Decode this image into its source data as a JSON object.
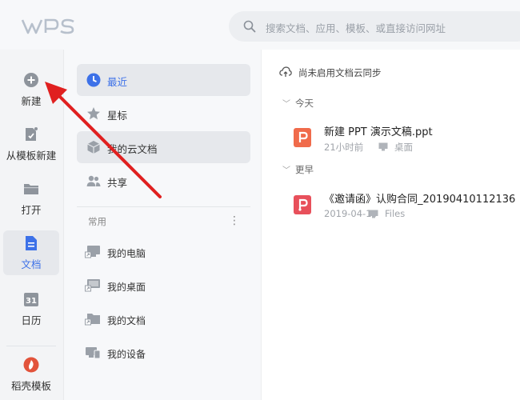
{
  "app": {
    "logo_text": "WPS"
  },
  "search": {
    "placeholder": "搜索文档、应用、模板、或直接访问网址"
  },
  "rail": {
    "items": [
      {
        "label": "新建"
      },
      {
        "label": "从模板新建"
      },
      {
        "label": "打开"
      },
      {
        "label": "文档"
      },
      {
        "label": "日历",
        "icon_text": "31"
      },
      {
        "label": "稻壳模板"
      }
    ]
  },
  "nav": {
    "items": [
      {
        "label": "最近"
      },
      {
        "label": "星标"
      },
      {
        "label": "我的云文档"
      },
      {
        "label": "共享"
      }
    ],
    "common_label": "常用",
    "more_glyph": "⋮",
    "common_items": [
      {
        "label": "我的电脑"
      },
      {
        "label": "我的桌面"
      },
      {
        "label": "我的文档"
      },
      {
        "label": "我的设备"
      }
    ]
  },
  "main": {
    "sync_text": "尚未启用文档云同步",
    "groups": [
      {
        "heading": "今天",
        "files": [
          {
            "name": "新建 PPT 演示文稿.ppt",
            "time": "21小时前",
            "location": "桌面",
            "icon_letter": "P",
            "icon_color": "#f06b4b"
          }
        ]
      },
      {
        "heading": "更早",
        "files": [
          {
            "name": "《邀请函》认购合同_20190410112136",
            "time": "2019-04-10",
            "location": "Files",
            "icon_letter": "P",
            "icon_color": "#e8505b"
          }
        ]
      }
    ]
  },
  "colors": {
    "accent": "#3d71e8",
    "annotation_arrow": "#e02020"
  }
}
